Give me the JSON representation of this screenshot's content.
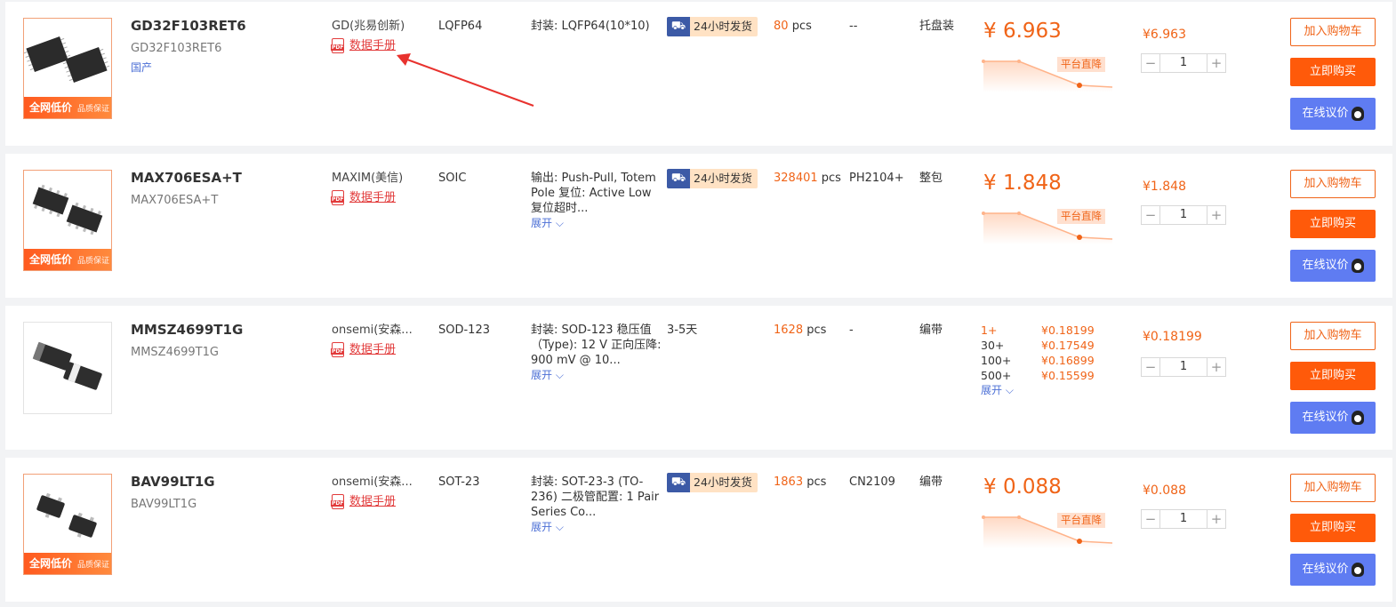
{
  "rows": [
    {
      "thumb_banner": "全网低价",
      "thumb_banner_sub": "品质保证",
      "part_number": "GD32F103RET6",
      "part_sub": "GD32F103RET6",
      "origin": "国产",
      "brand": "GD(兆易创新)",
      "datasheet": "数据手册",
      "package": "LQFP64",
      "desc": "封装: LQFP64(10*10)",
      "shipping": "24小时发货",
      "stock_num": "80",
      "stock_unit": "pcs",
      "date_code": "--",
      "packing": "托盘装",
      "price": "¥ 6.963",
      "price_tag": "平台直降",
      "unit_price": "¥6.963",
      "qty": "1",
      "cart": "加入购物车",
      "buy": "立即购买",
      "chat": "在线议价"
    },
    {
      "thumb_banner": "全网低价",
      "thumb_banner_sub": "品质保证",
      "part_number": "MAX706ESA+T",
      "part_sub": "MAX706ESA+T",
      "brand": "MAXIM(美信)",
      "datasheet": "数据手册",
      "package": "SOIC",
      "desc_lines": [
        "输出: Push-Pull, Totem",
        "Pole 复位: Active Low",
        "复位超时..."
      ],
      "more": "展开",
      "shipping": "24小时发货",
      "stock_num": "328401",
      "stock_unit": "pcs",
      "date_code": "PH2104+",
      "packing": "整包",
      "price": "¥ 1.848",
      "price_tag": "平台直降",
      "unit_price": "¥1.848",
      "qty": "1",
      "cart": "加入购物车",
      "buy": "立即购买",
      "chat": "在线议价"
    },
    {
      "part_number": "MMSZ4699T1G",
      "part_sub": "MMSZ4699T1G",
      "brand": "onsemi(安森...",
      "datasheet": "数据手册",
      "package": "SOD-123",
      "desc_lines": [
        "封装: SOD-123 稳压值",
        "（Type): 12 V 正向压降:",
        "900 mV @ 10..."
      ],
      "more": "展开",
      "shipping_text": "3-5天",
      "stock_num": "1628",
      "stock_unit": "pcs",
      "date_code": "-",
      "packing": "编带",
      "tiers": [
        {
          "qty": "1+",
          "price": "¥0.18199"
        },
        {
          "qty": "30+",
          "price": "¥0.17549"
        },
        {
          "qty": "100+",
          "price": "¥0.16899"
        },
        {
          "qty": "500+",
          "price": "¥0.15599"
        }
      ],
      "tiers_more": "展开",
      "unit_price": "¥0.18199",
      "qty": "1",
      "cart": "加入购物车",
      "buy": "立即购买",
      "chat": "在线议价"
    },
    {
      "thumb_banner": "全网低价",
      "thumb_banner_sub": "品质保证",
      "part_number": "BAV99LT1G",
      "part_sub": "BAV99LT1G",
      "brand": "onsemi(安森...",
      "datasheet": "数据手册",
      "package": "SOT-23",
      "desc_lines": [
        "封装: SOT-23-3 (TO-",
        "236) 二极管配置: 1 Pair",
        "Series Co..."
      ],
      "more": "展开",
      "shipping": "24小时发货",
      "stock_num": "1863",
      "stock_unit": "pcs",
      "date_code": "CN2109",
      "packing": "编带",
      "price": "¥ 0.088",
      "price_tag": "平台直降",
      "unit_price": "¥0.088",
      "qty": "1",
      "cart": "加入购物车",
      "buy": "立即购买",
      "chat": "在线议价"
    }
  ],
  "icons": {
    "minus": "−",
    "plus": "+",
    "chevron": "⌵",
    "truck": "⛟"
  },
  "colors": {
    "accent": "#f06418",
    "link": "#4d70d6",
    "chat": "#5f7cf2",
    "pdf": "#e23b3b",
    "annotation_arrow": "#e8322e"
  }
}
